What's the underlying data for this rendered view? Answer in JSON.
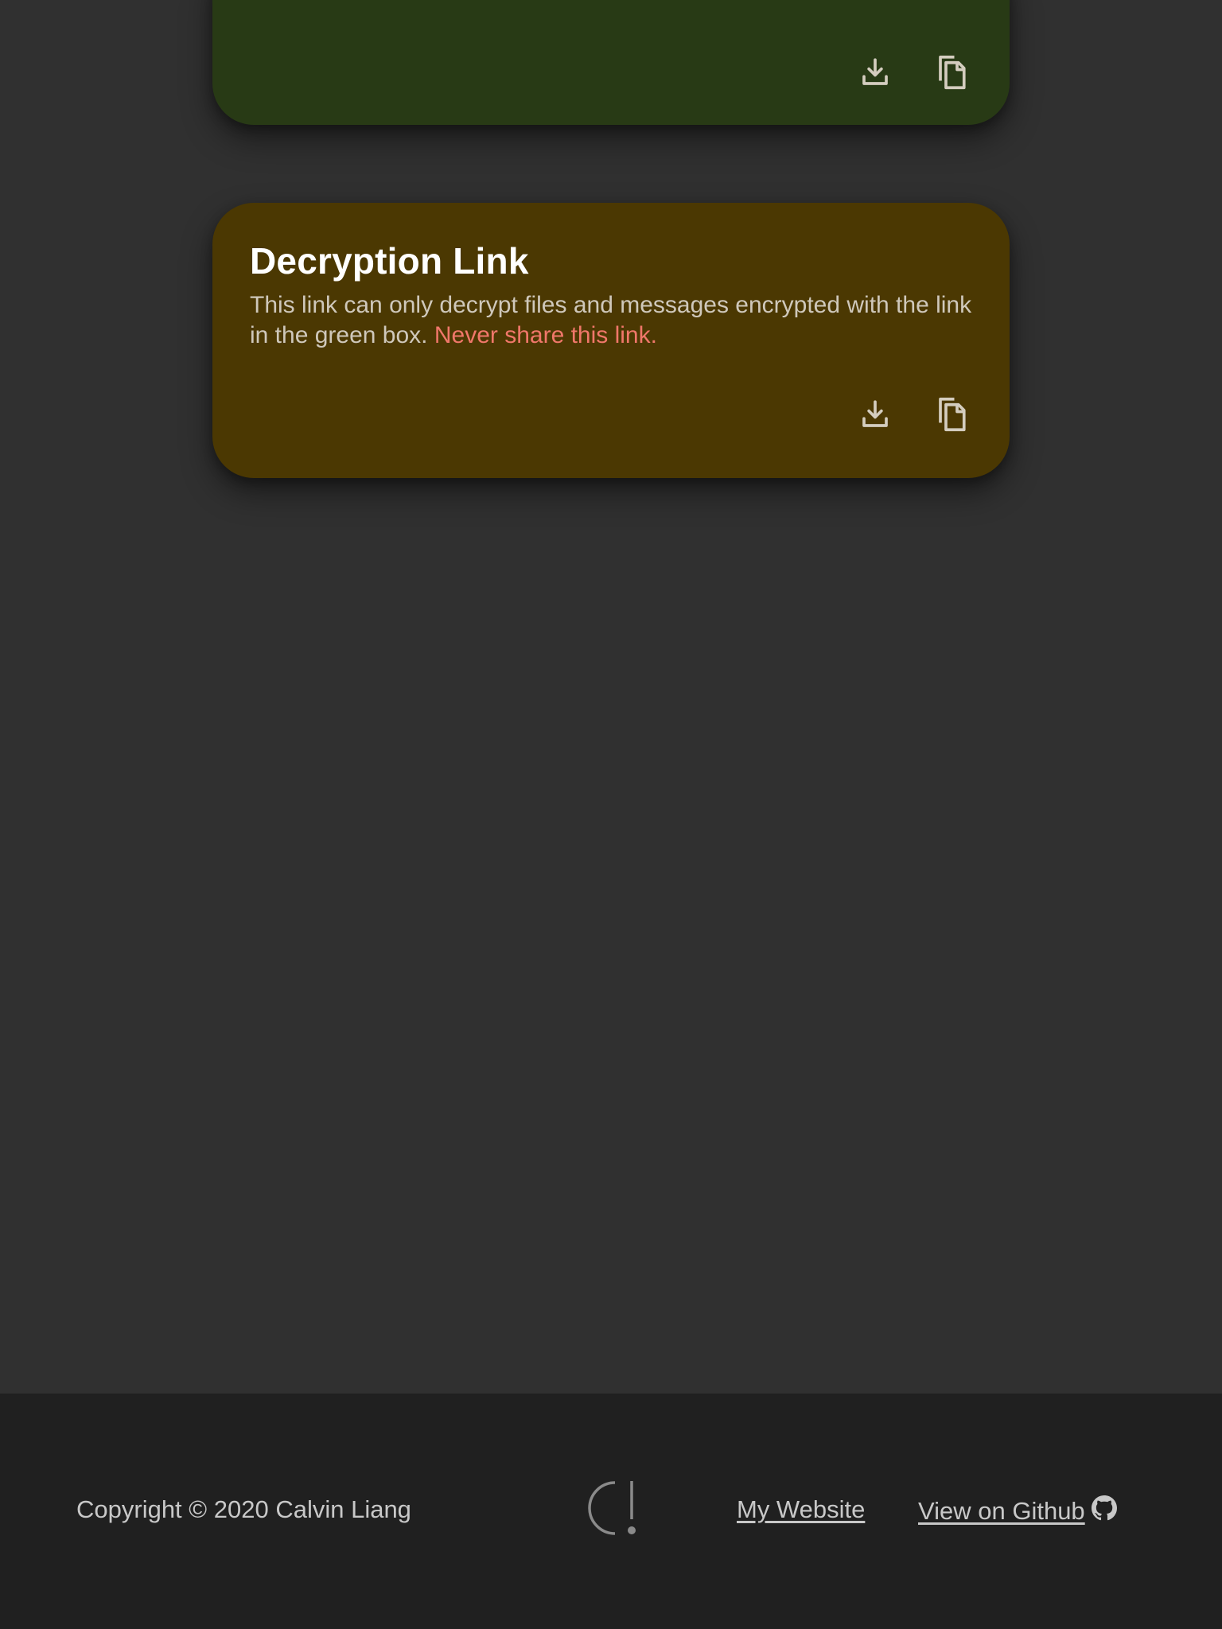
{
  "encryption_card": {
    "icons": {
      "download": "download-icon",
      "copy": "copy-icon"
    },
    "color": "#283a15"
  },
  "decryption_card": {
    "title": "Decryption Link",
    "description": "This link can only decrypt files and messages encrypted with the link in the green box.",
    "warning": "Never share this link.",
    "icons": {
      "download": "download-icon",
      "copy": "copy-icon"
    },
    "color": "#4b3802",
    "warning_color": "#f0776a"
  },
  "footer": {
    "copyright": "Copyright © 2020 Calvin Liang",
    "logo_icon": "logo-icon",
    "links": [
      {
        "label": "My Website"
      },
      {
        "label": "View on Github",
        "icon": "github-icon"
      }
    ]
  }
}
